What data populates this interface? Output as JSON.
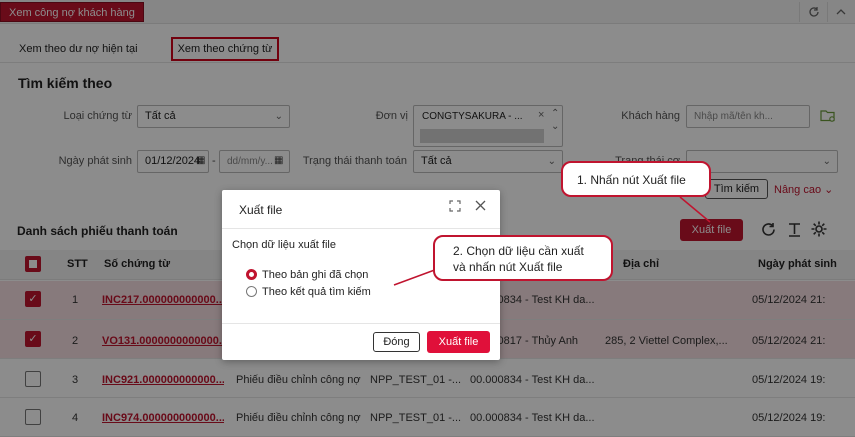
{
  "app_tab": "Xem công nợ khách hàng",
  "tabs": [
    "Xem theo dư nợ hiện tại",
    "Xem theo chứng từ"
  ],
  "search": {
    "title": "Tìm kiếm theo",
    "loai_ct_label": "Loại chứng từ",
    "loai_ct_value": "Tất cả",
    "don_vi_label": "Đơn vị",
    "don_vi_value": "CONGTYSAKURA - ...",
    "khach_hang_label": "Khách hàng",
    "khach_hang_placeholder": "Nhập mã/tên kh...",
    "ngay_ps_label": "Ngày phát sinh",
    "date_from": "01/12/2024",
    "date_sep": "-",
    "date_to_placeholder": "dd/mm/y...",
    "trang_thai_label": "Trạng thái thanh toán",
    "trang_thai_value": "Tất cả",
    "trang_thai_2_label": "Trạng thái cơ",
    "tim_kiem_btn": "Tìm kiếm",
    "nang_cao": "Nâng cao"
  },
  "list": {
    "title": "Danh sách phiếu thanh toán",
    "export_btn": "Xuất file",
    "headers": [
      "STT",
      "Số chứng từ",
      "",
      "",
      "",
      "Địa chỉ",
      "Ngày phát sinh"
    ],
    "rows": [
      {
        "stt": "1",
        "so_ct": "INC217.000000000000...",
        "loai": "",
        "don_vi": "",
        "kh": "00.000834 - Test KH da...",
        "dia_chi": "",
        "ngay": "05/12/2024 21:",
        "checked": true
      },
      {
        "stt": "2",
        "so_ct": "VO131.0000000000000...",
        "loai": "",
        "don_vi": "",
        "kh": "00.000817 - Thủy Anh",
        "dia_chi": "285, 2 Viettel Complex,...",
        "ngay": "05/12/2024 21:",
        "checked": true
      },
      {
        "stt": "3",
        "so_ct": "INC921.000000000000...",
        "loai": "Phiếu điều chỉnh công nợ",
        "don_vi": "NPP_TEST_01 -...",
        "kh": "00.000834 - Test KH da...",
        "dia_chi": "",
        "ngay": "05/12/2024 19:",
        "checked": false
      },
      {
        "stt": "4",
        "so_ct": "INC974.000000000000...",
        "loai": "Phiếu điều chỉnh công nợ",
        "don_vi": "NPP_TEST_01 -...",
        "kh": "00.000834 - Test KH da...",
        "dia_chi": "",
        "ngay": "05/12/2024 19:",
        "checked": false
      }
    ]
  },
  "modal": {
    "title": "Xuất file",
    "prompt": "Chọn dữ liệu xuất file",
    "option1": "Theo bản ghi đã chọn",
    "option2": "Theo kết quả tìm kiếm",
    "close_btn": "Đóng",
    "export_btn": "Xuất file"
  },
  "callouts": {
    "step1": "1. Nhấn nút Xuất file",
    "step2_line1": "2. Chọn dữ liệu cần xuất",
    "step2_line2": "và nhấn nút Xuất file"
  },
  "colors": {
    "accent": "#c0142f"
  }
}
